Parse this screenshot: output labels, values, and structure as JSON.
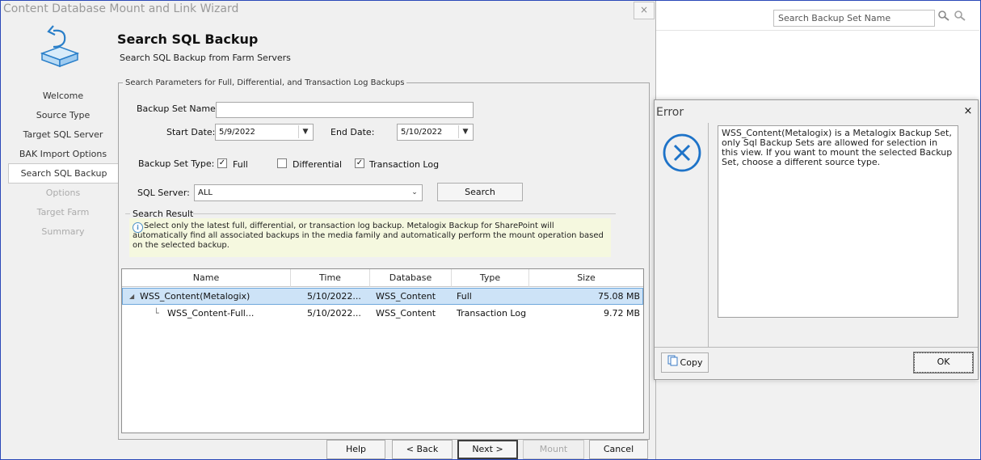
{
  "wizard": {
    "title": "Content Database Mount and Link Wizard",
    "close_glyph": "×",
    "heading": "Search SQL Backup",
    "subheading": "Search SQL Backup from Farm Servers",
    "nav": [
      {
        "label": "Welcome",
        "state": "normal"
      },
      {
        "label": "Source Type",
        "state": "normal"
      },
      {
        "label": "Target SQL Server",
        "state": "normal"
      },
      {
        "label": "BAK Import Options",
        "state": "normal"
      },
      {
        "label": "Search SQL Backup",
        "state": "active"
      },
      {
        "label": "Options",
        "state": "disabled"
      },
      {
        "label": "Target Farm",
        "state": "disabled"
      },
      {
        "label": "Summary",
        "state": "disabled"
      }
    ],
    "params": {
      "group_label": "Search Parameters for Full, Differential, and Transaction Log Backups",
      "backup_set_name_label": "Backup Set Name:",
      "backup_set_name_value": "",
      "start_date_label": "Start Date:",
      "start_date_value": "5/9/2022",
      "end_date_label": "End Date:",
      "end_date_value": "5/10/2022",
      "backup_set_type_label": "Backup Set Type:",
      "types": [
        {
          "label": "Full",
          "checked": true
        },
        {
          "label": "Differential",
          "checked": false
        },
        {
          "label": "Transaction Log",
          "checked": true
        }
      ],
      "sql_server_label": "SQL Server:",
      "sql_server_value": "ALL",
      "search_button": "Search",
      "check_glyph": "✓"
    },
    "result": {
      "label": "Search Result",
      "info_icon": "i",
      "info_text": "Select only the latest full, differential, or transaction log backup. Metalogix Backup for SharePoint will automatically find all associated backups in the media family and automatically perform the mount operation based on the selected backup.",
      "columns": [
        "Name",
        "Time",
        "Database",
        "Type",
        "Size"
      ],
      "rows": [
        {
          "name": "WSS_Content(Metalogix)",
          "time": "5/10/2022...",
          "database": "WSS_Content",
          "type": "Full",
          "size": "75.08 MB",
          "expander": "◢",
          "selected": true
        },
        {
          "name": "WSS_Content-Full...",
          "time": "5/10/2022...",
          "database": "WSS_Content",
          "type": "Transaction Log",
          "size": "9.72 MB",
          "tree_glyph": "└",
          "selected": false
        }
      ]
    },
    "footer": {
      "help": "Help",
      "back": "< Back",
      "next": "Next >",
      "mount": "Mount",
      "cancel": "Cancel"
    }
  },
  "background": {
    "search_placeholder": "Search Backup Set Name"
  },
  "error_dialog": {
    "title": "Error",
    "close_glyph": "×",
    "message": "WSS_Content(Metalogix) is a Metalogix Backup Set, only Sql Backup Sets are allowed for selection in this view. If you want to mount the selected Backup Set, choose a different source type.",
    "copy_button": "Copy",
    "ok_button": "OK",
    "icon": "error-circle-x",
    "icon_color": "#1e73c8"
  },
  "colors": {
    "accent": "#1e73c8",
    "selection": "#cde3f7",
    "info_background": "#f5f8df"
  }
}
